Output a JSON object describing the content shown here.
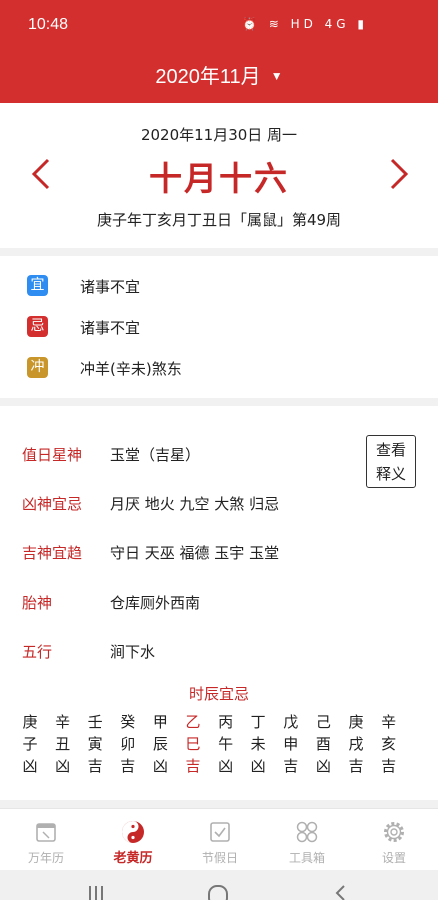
{
  "status_bar": {
    "time": "10:48",
    "icons_text": "⏰ ≋ HD 4G ▮"
  },
  "header": {
    "month_label": "2020年11月"
  },
  "date": {
    "solar": "2020年11月30日 周一",
    "lunar": "十月十六",
    "ganzhi": "庚子年丁亥月丁丑日「属鼠」第49周"
  },
  "almanac": {
    "yi": {
      "tag": "宜",
      "text": "诸事不宜",
      "color": "#2f8cf0"
    },
    "ji": {
      "tag": "忌",
      "text": "诸事不宜",
      "color": "#d32f2f"
    },
    "chong": {
      "tag": "冲",
      "text": "冲羊(辛未)煞东",
      "color": "#c8962a"
    }
  },
  "details": [
    {
      "label": "值日星神",
      "value": "玉堂（吉星）"
    },
    {
      "label": "凶神宜忌",
      "value": "月厌 地火 九空 大煞 归忌"
    },
    {
      "label": "吉神宜趋",
      "value": "守日 天巫 福德 玉宇 玉堂"
    },
    {
      "label": "胎神",
      "value": "仓库厕外西南"
    },
    {
      "label": "五行",
      "value": "涧下水"
    }
  ],
  "explain_button": {
    "line1": "查看",
    "line2": "释义"
  },
  "shichen": {
    "title": "时辰宜忌",
    "columns": [
      {
        "gan": "庚",
        "zhi": "子",
        "luck": "凶",
        "current": false
      },
      {
        "gan": "辛",
        "zhi": "丑",
        "luck": "凶",
        "current": false
      },
      {
        "gan": "壬",
        "zhi": "寅",
        "luck": "吉",
        "current": false
      },
      {
        "gan": "癸",
        "zhi": "卯",
        "luck": "吉",
        "current": false
      },
      {
        "gan": "甲",
        "zhi": "辰",
        "luck": "凶",
        "current": false
      },
      {
        "gan": "乙",
        "zhi": "巳",
        "luck": "吉",
        "current": true
      },
      {
        "gan": "丙",
        "zhi": "午",
        "luck": "凶",
        "current": false
      },
      {
        "gan": "丁",
        "zhi": "未",
        "luck": "凶",
        "current": false
      },
      {
        "gan": "戊",
        "zhi": "申",
        "luck": "吉",
        "current": false
      },
      {
        "gan": "己",
        "zhi": "酉",
        "luck": "凶",
        "current": false
      },
      {
        "gan": "庚",
        "zhi": "戌",
        "luck": "吉",
        "current": false
      },
      {
        "gan": "辛",
        "zhi": "亥",
        "luck": "吉",
        "current": false
      }
    ]
  },
  "bottom_nav": {
    "items": [
      {
        "label": "万年历",
        "icon": "calendar-icon",
        "active": false
      },
      {
        "label": "老黄历",
        "icon": "yin-yang-icon",
        "active": true
      },
      {
        "label": "节假日",
        "icon": "holiday-check-icon",
        "active": false
      },
      {
        "label": "工具箱",
        "icon": "toolbox-icon",
        "active": false
      },
      {
        "label": "设置",
        "icon": "gear-icon",
        "active": false
      }
    ]
  },
  "colors": {
    "brand_red": "#d32f2f",
    "accent_red": "#c62828",
    "inactive_gray": "#b0b0b0"
  }
}
